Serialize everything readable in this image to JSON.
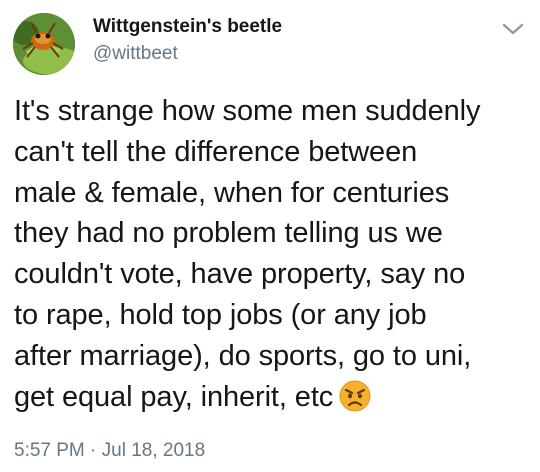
{
  "tweet": {
    "author": {
      "display_name": "Wittgenstein's beetle",
      "handle": "@wittbeet",
      "avatar_icon": "beetle-avatar-icon"
    },
    "menu_icon": "chevron-down-icon",
    "text_lines": [
      "It's strange how some men suddenly",
      "can't tell the difference between",
      "male & female, when for centuries",
      "they had no problem telling us we",
      "couldn't vote, have property, say no",
      "to rape, hold top jobs (or any job",
      "after marriage), do sports, go to uni,",
      "get equal pay, inherit, etc"
    ],
    "trailing_emoji": "angry-face-emoji",
    "timestamp": "5:57 PM · Jul 18, 2018"
  },
  "colors": {
    "text": "#14171a",
    "secondary_text": "#657786",
    "background": "#ffffff",
    "emoji_face": "#f7b02c"
  }
}
